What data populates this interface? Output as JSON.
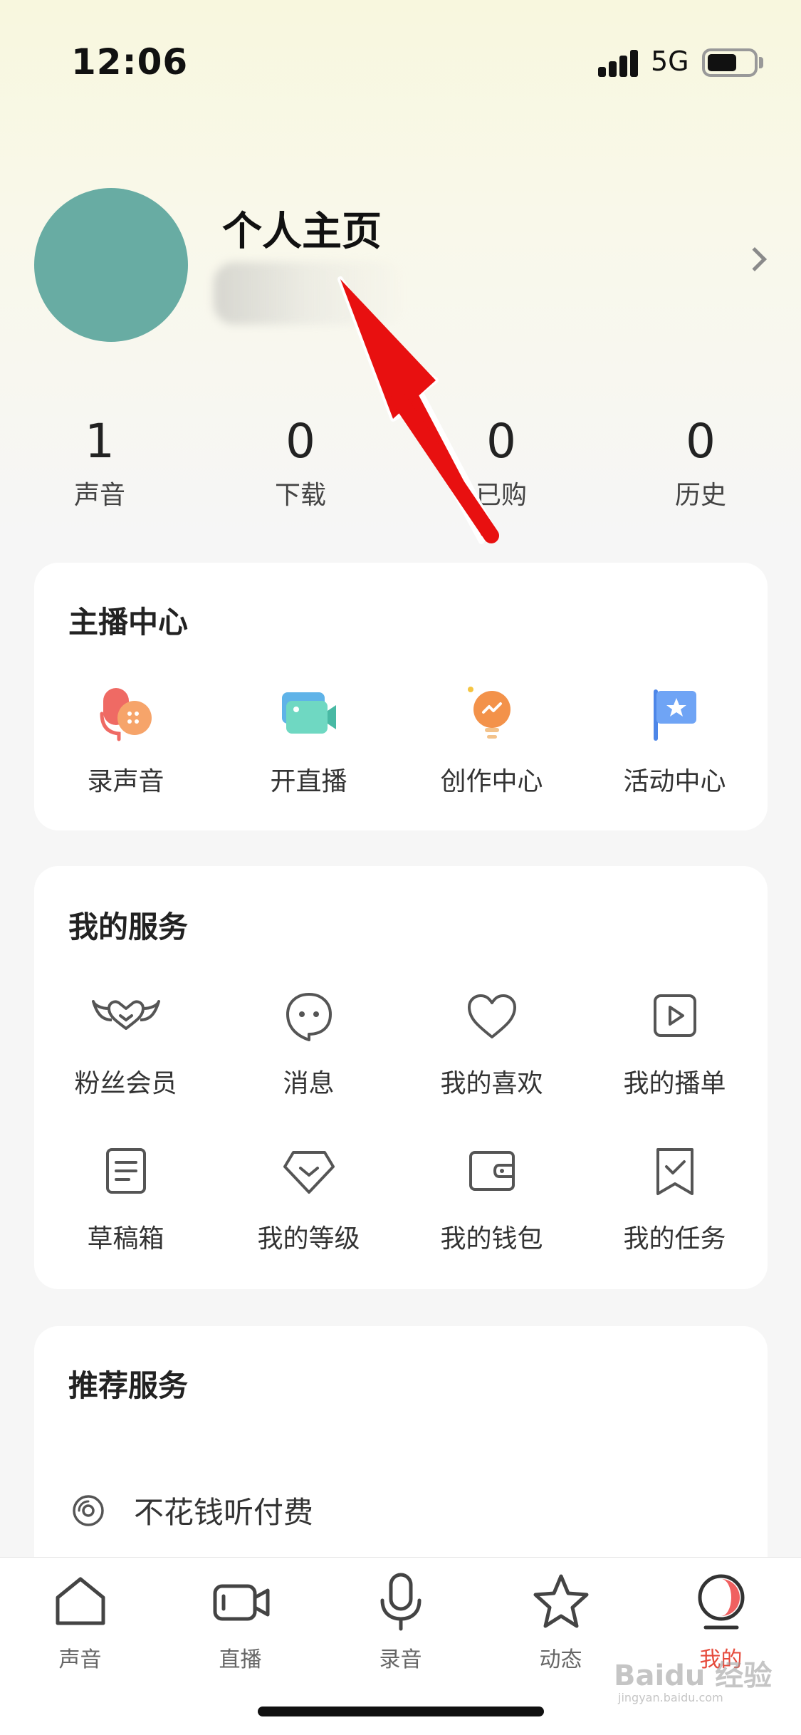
{
  "status_bar": {
    "time": "12:06",
    "network": "5G"
  },
  "profile": {
    "title": "个人主页"
  },
  "stats": [
    {
      "value": "1",
      "label": "声音"
    },
    {
      "value": "0",
      "label": "下载"
    },
    {
      "value": "0",
      "label": "已购"
    },
    {
      "value": "0",
      "label": "历史"
    }
  ],
  "anchor_center": {
    "title": "主播中心",
    "items": [
      {
        "label": "录声音",
        "icon": "record-voice-icon"
      },
      {
        "label": "开直播",
        "icon": "live-camera-icon"
      },
      {
        "label": "创作中心",
        "icon": "lightbulb-icon"
      },
      {
        "label": "活动中心",
        "icon": "flag-star-icon"
      }
    ]
  },
  "my_services": {
    "title": "我的服务",
    "items": [
      {
        "label": "粉丝会员",
        "icon": "wings-heart-icon"
      },
      {
        "label": "消息",
        "icon": "message-bubble-icon"
      },
      {
        "label": "我的喜欢",
        "icon": "heart-icon"
      },
      {
        "label": "我的播单",
        "icon": "play-list-icon"
      },
      {
        "label": "草稿箱",
        "icon": "draft-document-icon"
      },
      {
        "label": "我的等级",
        "icon": "diamond-level-icon"
      },
      {
        "label": "我的钱包",
        "icon": "wallet-icon"
      },
      {
        "label": "我的任务",
        "icon": "task-bookmark-icon"
      }
    ]
  },
  "recommend": {
    "title": "推荐服务",
    "items": [
      {
        "label": "不花钱听付费",
        "icon": "disc-icon"
      }
    ]
  },
  "tabbar": [
    {
      "label": "声音",
      "icon": "home-icon",
      "active": false
    },
    {
      "label": "直播",
      "icon": "video-camera-icon",
      "active": false
    },
    {
      "label": "录音",
      "icon": "microphone-icon",
      "active": false
    },
    {
      "label": "动态",
      "icon": "star-icon",
      "active": false
    },
    {
      "label": "我的",
      "icon": "profile-orb-icon",
      "active": true
    }
  ],
  "watermark": {
    "text": "Baidu 经验",
    "sub": "jingyan.baidu.com"
  },
  "colors": {
    "accent": "#e64b3c",
    "avatar": "#68aca3",
    "annotation": "#e81010"
  }
}
